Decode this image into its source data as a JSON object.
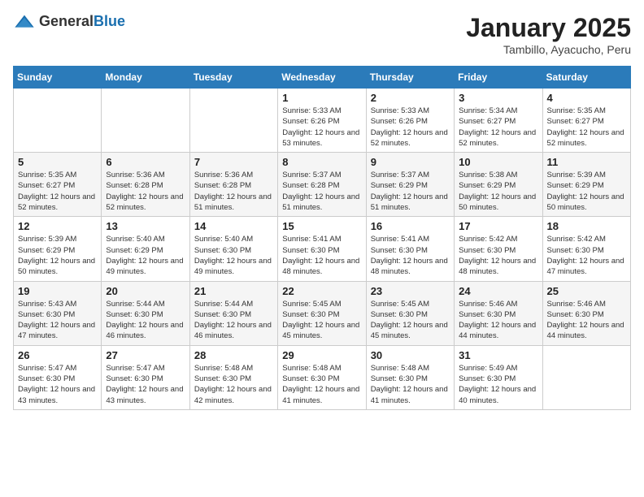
{
  "header": {
    "logo_general": "General",
    "logo_blue": "Blue",
    "month_title": "January 2025",
    "location": "Tambillo, Ayacucho, Peru"
  },
  "weekdays": [
    "Sunday",
    "Monday",
    "Tuesday",
    "Wednesday",
    "Thursday",
    "Friday",
    "Saturday"
  ],
  "weeks": [
    [
      {
        "day": "",
        "sunrise": "",
        "sunset": "",
        "daylight": ""
      },
      {
        "day": "",
        "sunrise": "",
        "sunset": "",
        "daylight": ""
      },
      {
        "day": "",
        "sunrise": "",
        "sunset": "",
        "daylight": ""
      },
      {
        "day": "1",
        "sunrise": "Sunrise: 5:33 AM",
        "sunset": "Sunset: 6:26 PM",
        "daylight": "Daylight: 12 hours and 53 minutes."
      },
      {
        "day": "2",
        "sunrise": "Sunrise: 5:33 AM",
        "sunset": "Sunset: 6:26 PM",
        "daylight": "Daylight: 12 hours and 52 minutes."
      },
      {
        "day": "3",
        "sunrise": "Sunrise: 5:34 AM",
        "sunset": "Sunset: 6:27 PM",
        "daylight": "Daylight: 12 hours and 52 minutes."
      },
      {
        "day": "4",
        "sunrise": "Sunrise: 5:35 AM",
        "sunset": "Sunset: 6:27 PM",
        "daylight": "Daylight: 12 hours and 52 minutes."
      }
    ],
    [
      {
        "day": "5",
        "sunrise": "Sunrise: 5:35 AM",
        "sunset": "Sunset: 6:27 PM",
        "daylight": "Daylight: 12 hours and 52 minutes."
      },
      {
        "day": "6",
        "sunrise": "Sunrise: 5:36 AM",
        "sunset": "Sunset: 6:28 PM",
        "daylight": "Daylight: 12 hours and 52 minutes."
      },
      {
        "day": "7",
        "sunrise": "Sunrise: 5:36 AM",
        "sunset": "Sunset: 6:28 PM",
        "daylight": "Daylight: 12 hours and 51 minutes."
      },
      {
        "day": "8",
        "sunrise": "Sunrise: 5:37 AM",
        "sunset": "Sunset: 6:28 PM",
        "daylight": "Daylight: 12 hours and 51 minutes."
      },
      {
        "day": "9",
        "sunrise": "Sunrise: 5:37 AM",
        "sunset": "Sunset: 6:29 PM",
        "daylight": "Daylight: 12 hours and 51 minutes."
      },
      {
        "day": "10",
        "sunrise": "Sunrise: 5:38 AM",
        "sunset": "Sunset: 6:29 PM",
        "daylight": "Daylight: 12 hours and 50 minutes."
      },
      {
        "day": "11",
        "sunrise": "Sunrise: 5:39 AM",
        "sunset": "Sunset: 6:29 PM",
        "daylight": "Daylight: 12 hours and 50 minutes."
      }
    ],
    [
      {
        "day": "12",
        "sunrise": "Sunrise: 5:39 AM",
        "sunset": "Sunset: 6:29 PM",
        "daylight": "Daylight: 12 hours and 50 minutes."
      },
      {
        "day": "13",
        "sunrise": "Sunrise: 5:40 AM",
        "sunset": "Sunset: 6:29 PM",
        "daylight": "Daylight: 12 hours and 49 minutes."
      },
      {
        "day": "14",
        "sunrise": "Sunrise: 5:40 AM",
        "sunset": "Sunset: 6:30 PM",
        "daylight": "Daylight: 12 hours and 49 minutes."
      },
      {
        "day": "15",
        "sunrise": "Sunrise: 5:41 AM",
        "sunset": "Sunset: 6:30 PM",
        "daylight": "Daylight: 12 hours and 48 minutes."
      },
      {
        "day": "16",
        "sunrise": "Sunrise: 5:41 AM",
        "sunset": "Sunset: 6:30 PM",
        "daylight": "Daylight: 12 hours and 48 minutes."
      },
      {
        "day": "17",
        "sunrise": "Sunrise: 5:42 AM",
        "sunset": "Sunset: 6:30 PM",
        "daylight": "Daylight: 12 hours and 48 minutes."
      },
      {
        "day": "18",
        "sunrise": "Sunrise: 5:42 AM",
        "sunset": "Sunset: 6:30 PM",
        "daylight": "Daylight: 12 hours and 47 minutes."
      }
    ],
    [
      {
        "day": "19",
        "sunrise": "Sunrise: 5:43 AM",
        "sunset": "Sunset: 6:30 PM",
        "daylight": "Daylight: 12 hours and 47 minutes."
      },
      {
        "day": "20",
        "sunrise": "Sunrise: 5:44 AM",
        "sunset": "Sunset: 6:30 PM",
        "daylight": "Daylight: 12 hours and 46 minutes."
      },
      {
        "day": "21",
        "sunrise": "Sunrise: 5:44 AM",
        "sunset": "Sunset: 6:30 PM",
        "daylight": "Daylight: 12 hours and 46 minutes."
      },
      {
        "day": "22",
        "sunrise": "Sunrise: 5:45 AM",
        "sunset": "Sunset: 6:30 PM",
        "daylight": "Daylight: 12 hours and 45 minutes."
      },
      {
        "day": "23",
        "sunrise": "Sunrise: 5:45 AM",
        "sunset": "Sunset: 6:30 PM",
        "daylight": "Daylight: 12 hours and 45 minutes."
      },
      {
        "day": "24",
        "sunrise": "Sunrise: 5:46 AM",
        "sunset": "Sunset: 6:30 PM",
        "daylight": "Daylight: 12 hours and 44 minutes."
      },
      {
        "day": "25",
        "sunrise": "Sunrise: 5:46 AM",
        "sunset": "Sunset: 6:30 PM",
        "daylight": "Daylight: 12 hours and 44 minutes."
      }
    ],
    [
      {
        "day": "26",
        "sunrise": "Sunrise: 5:47 AM",
        "sunset": "Sunset: 6:30 PM",
        "daylight": "Daylight: 12 hours and 43 minutes."
      },
      {
        "day": "27",
        "sunrise": "Sunrise: 5:47 AM",
        "sunset": "Sunset: 6:30 PM",
        "daylight": "Daylight: 12 hours and 43 minutes."
      },
      {
        "day": "28",
        "sunrise": "Sunrise: 5:48 AM",
        "sunset": "Sunset: 6:30 PM",
        "daylight": "Daylight: 12 hours and 42 minutes."
      },
      {
        "day": "29",
        "sunrise": "Sunrise: 5:48 AM",
        "sunset": "Sunset: 6:30 PM",
        "daylight": "Daylight: 12 hours and 41 minutes."
      },
      {
        "day": "30",
        "sunrise": "Sunrise: 5:48 AM",
        "sunset": "Sunset: 6:30 PM",
        "daylight": "Daylight: 12 hours and 41 minutes."
      },
      {
        "day": "31",
        "sunrise": "Sunrise: 5:49 AM",
        "sunset": "Sunset: 6:30 PM",
        "daylight": "Daylight: 12 hours and 40 minutes."
      },
      {
        "day": "",
        "sunrise": "",
        "sunset": "",
        "daylight": ""
      }
    ]
  ]
}
